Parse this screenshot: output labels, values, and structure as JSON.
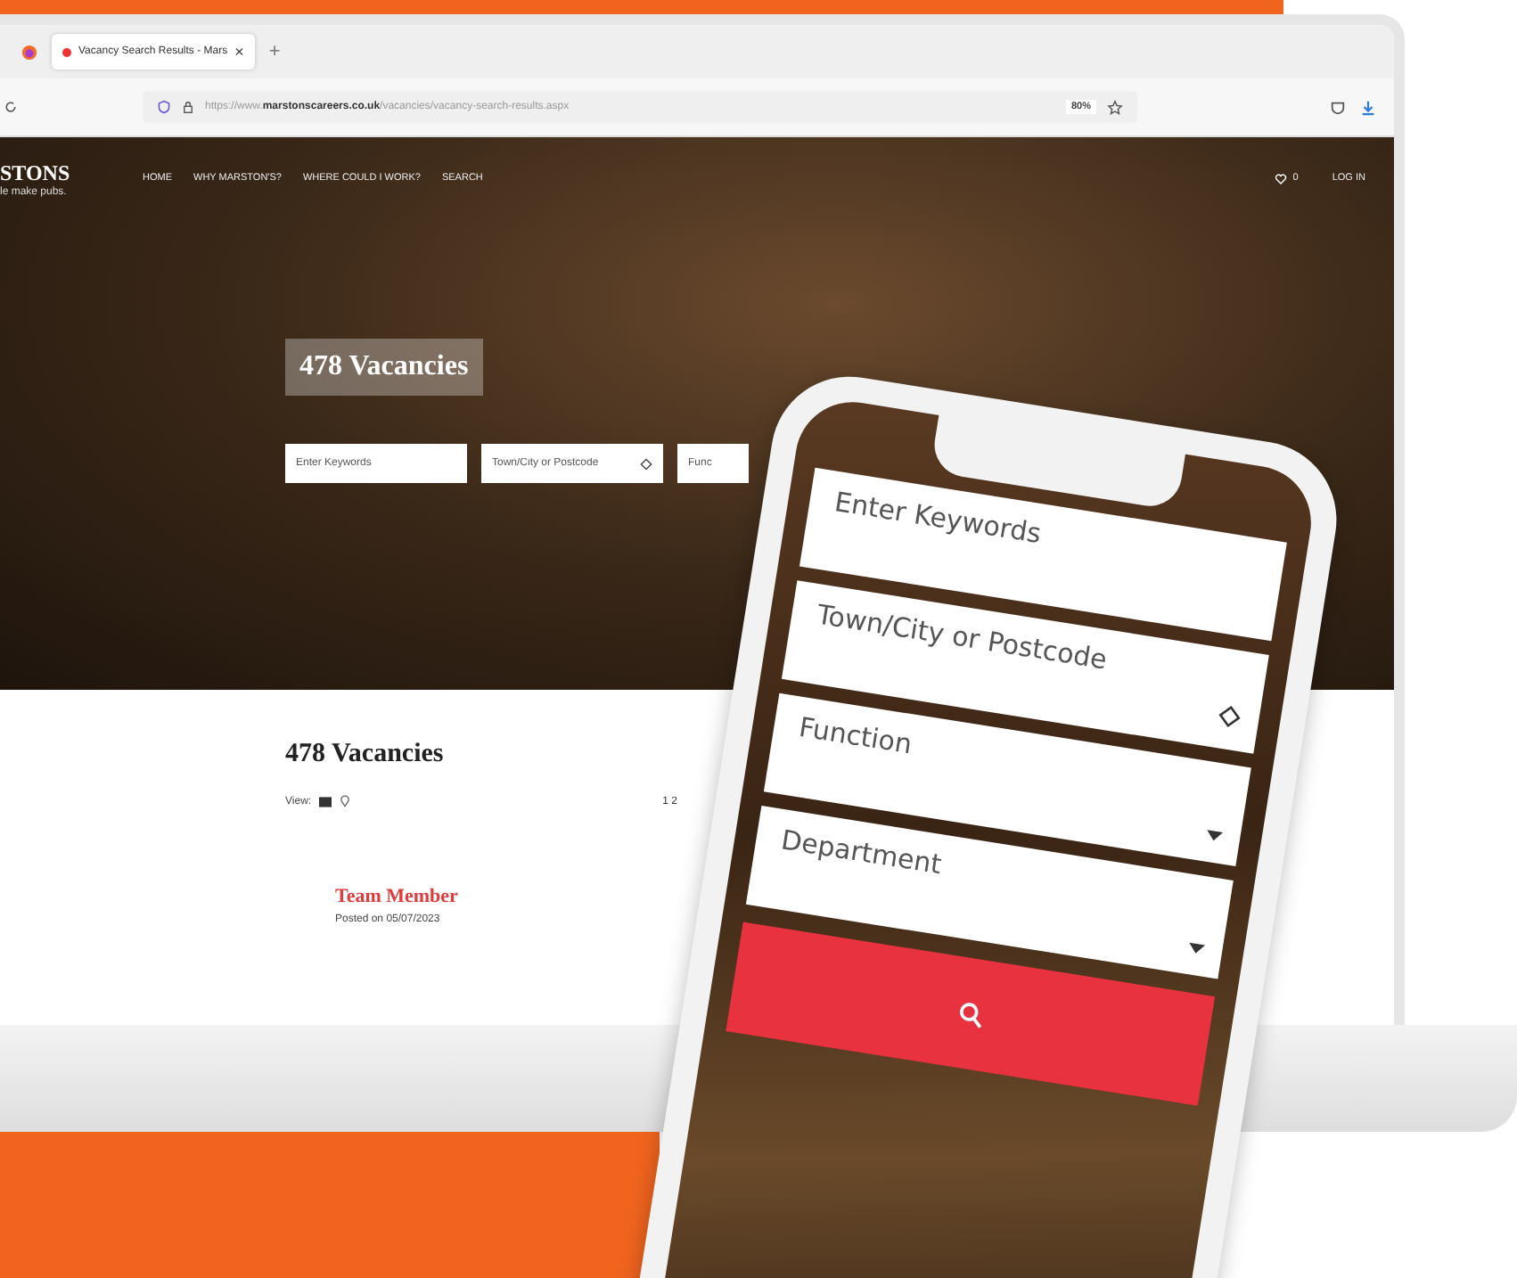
{
  "browser": {
    "tab": {
      "title": "Vacancy Search Results - Mars",
      "close": "×"
    },
    "new_tab": "+",
    "url": "https://www.**marstonscareers.co.uk**/vacancies/vacancy-search-results.aspx",
    "zoom": "80%"
  },
  "site": {
    "logo": "STONS",
    "tagline": "le make pubs.",
    "nav": [
      "HOME",
      "WHY MARSTON'S?",
      "WHERE COULD I WORK?",
      "SEARCH"
    ],
    "favourites_count": "0",
    "login": "LOG IN"
  },
  "hero": {
    "title": "478 Vacancies",
    "fields": [
      {
        "placeholder": "Enter Keywords",
        "kind": "text"
      },
      {
        "placeholder": "Town/City or Postcode",
        "kind": "location"
      },
      {
        "placeholder": "Func",
        "kind": "select"
      }
    ]
  },
  "results": {
    "title": "478 Vacancies",
    "view_label": "View:",
    "pagination": "1 2",
    "jobs": [
      {
        "title": "Team Member",
        "posted": "Posted on 05/07/2023"
      }
    ]
  },
  "phone": {
    "fields": [
      {
        "placeholder": "Enter Keywords",
        "kind": "text"
      },
      {
        "placeholder": "Town/City or Postcode",
        "kind": "location"
      },
      {
        "placeholder": "Function",
        "kind": "select"
      },
      {
        "placeholder": "Department",
        "kind": "select"
      }
    ]
  }
}
